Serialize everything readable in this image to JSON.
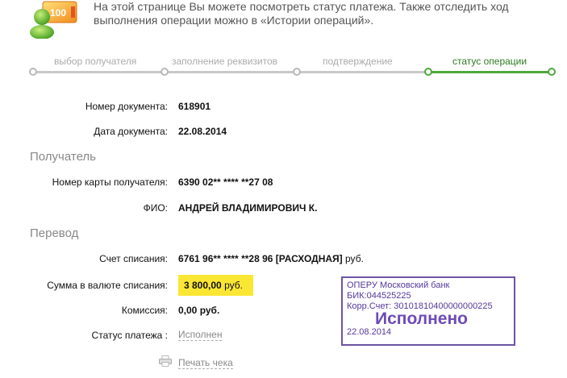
{
  "header": {
    "text": "На этой странице Вы можете посмотреть статус платежа. Также отследить ход выполнения операции можно в «Истории операций».",
    "icon": "money-user-icon",
    "icon_badge": "100"
  },
  "steps": [
    {
      "label": "выбор получателя",
      "active": false
    },
    {
      "label": "заполнение реквизитов",
      "active": false
    },
    {
      "label": "подтверждение",
      "active": false
    },
    {
      "label": "статус операции",
      "active": true
    }
  ],
  "document": {
    "number_label": "Номер документа:",
    "number_value": "618901",
    "date_label": "Дата документа:",
    "date_value": "22.08.2014"
  },
  "recipient": {
    "section_title": "Получатель",
    "card_label": "Номер карты получателя:",
    "card_value": "6390 02** **** **27 08",
    "name_label": "ФИО:",
    "name_value": "АНДРЕЙ ВЛАДИМИРОВИЧ К."
  },
  "transfer": {
    "section_title": "Перевод",
    "account_label": "Счет списания:",
    "account_value": "6761 96** **** **28 96  [РАСХОДНАЯ]",
    "account_currency": "руб.",
    "amount_label": "Сумма в валюте списания:",
    "amount_value": "3 800,00",
    "amount_currency": "руб.",
    "fee_label": "Комиссия:",
    "fee_value": "0,00 руб.",
    "status_label": "Статус платежа :",
    "status_value": "Исполнен"
  },
  "print_label": "Печать чека",
  "stamp": {
    "bank": "ОПЕРУ Московский банк",
    "bik": "БИК:044525225",
    "corr": "Корр.Счет: 30101810400000000225",
    "status": "Исполнено",
    "date": "22.08.2014"
  },
  "colors": {
    "active_step": "#4ea83d",
    "amount_highlight": "#fbe634",
    "stamp": "#6d53a3"
  }
}
